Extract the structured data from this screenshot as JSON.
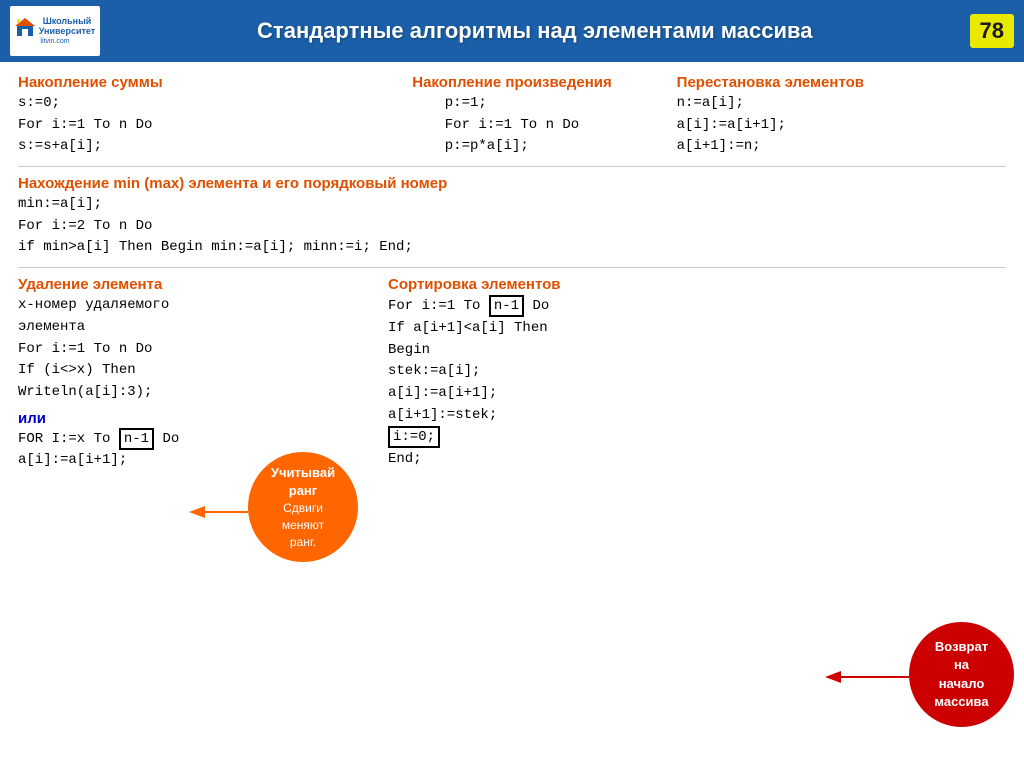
{
  "header": {
    "title": "Стандартные алгоритмы над элементами массива",
    "page_number": "78",
    "logo_line1": "Школьный",
    "logo_line2": "Университет",
    "logo_line3": "litvin.com"
  },
  "section1": {
    "title": "Накопление суммы",
    "code": [
      "s:=0;",
      "For i:=1 To n Do",
      " s:=s+a[i];"
    ]
  },
  "section2": {
    "title": "Накопление произведения",
    "code": [
      "p:=1;",
      "For i:=1 To n Do",
      " p:=p*a[i];"
    ]
  },
  "section3": {
    "title": "Перестановка элементов",
    "code": [
      "n:=a[i];",
      "a[i]:=a[i+1];",
      "a[i+1]:=n;"
    ]
  },
  "section4": {
    "title": "Нахождение  min (max) элемента и его порядковый номер",
    "code": [
      "min:=a[i];",
      "For i:=2 To n Do",
      " if  min>a[i] Then Begin min:=a[i]; minn:=i; End;"
    ]
  },
  "section5": {
    "title": "Удаление элемента",
    "code": [
      "x-номер  удаляемого",
      "элемента",
      "For i:=1 To n Do",
      " If (i<>x) Then",
      "  Writeln(a[i]:3);"
    ],
    "blue_text": "или",
    "code2": [
      "FOR I:=x To",
      " a[i]:=a[i+1];"
    ],
    "highlight": "n-1",
    "code2_do": " Do"
  },
  "section6": {
    "title": "Сортировка элементов",
    "code_line1_pre": "For i:=1 To ",
    "code_line1_highlight": "n-1",
    "code_line1_post": " Do",
    "code": [
      "If a[i+1]<a[i] Then",
      " Begin",
      "  stek:=a[i];",
      "  a[i]:=a[i+1];",
      "  a[i+1]:=stek;"
    ],
    "highlight2": "i:=0;",
    "code_end": "End;"
  },
  "callout1": {
    "line1": "Учитывай",
    "line2": "ранг",
    "line3": "Сдвиги",
    "line4": "меняют",
    "line5": "ранг."
  },
  "callout2": {
    "line1": "Возврат",
    "line2": "на",
    "line3": "начало",
    "line4": "массива"
  }
}
